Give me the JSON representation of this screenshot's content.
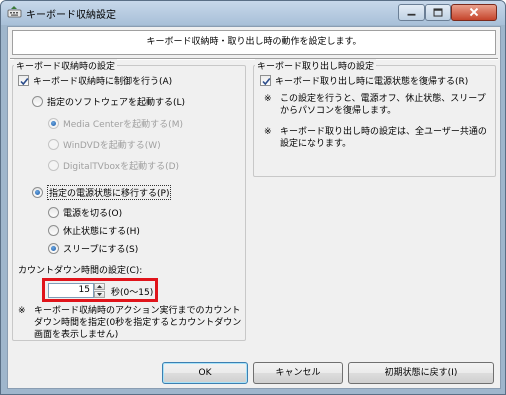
{
  "window": {
    "title": "キーボード収納設定",
    "icon": "keyboard-app-icon",
    "controls": [
      "minimize-icon",
      "maximize-icon",
      "close-icon"
    ]
  },
  "header": {
    "text": "キーボード収納時・取り出し時の動作を設定します。"
  },
  "storage": {
    "group_title": "キーボード収納時の設定",
    "control_checkbox": {
      "label": "キーボード収納時に制御を行う(A)",
      "checked": true
    },
    "launch_software": {
      "label": "指定のソフトウェアを起動する(L)",
      "selected": false,
      "options": [
        {
          "label": "Media Centerを起動する(M)",
          "selected": true,
          "enabled": false
        },
        {
          "label": "WinDVDを起動する(W)",
          "selected": false,
          "enabled": false
        },
        {
          "label": "DigitalTVboxを起動する(D)",
          "selected": false,
          "enabled": false
        }
      ]
    },
    "power_state": {
      "label": "指定の電源状態に移行する(P)",
      "selected": true,
      "options": [
        {
          "label": "電源を切る(O)",
          "selected": false
        },
        {
          "label": "休止状態にする(H)",
          "selected": false
        },
        {
          "label": "スリープにする(S)",
          "selected": true
        }
      ]
    },
    "countdown": {
      "label": "カウントダウン時間の設定(C):",
      "value": "15",
      "unit": "秒(0～15)",
      "note_mark": "※",
      "note": "キーボード収納時のアクション実行までのカウントダウン時間を指定(0秒を指定するとカウントダウン画面を表示しません)"
    }
  },
  "removal": {
    "group_title": "キーボード取り出し時の設定",
    "restore_checkbox": {
      "label": "キーボード取り出し時に電源状態を復帰する(R)",
      "checked": true
    },
    "notes": [
      {
        "mark": "※",
        "text": "この設定を行うと、電源オフ、休止状態、スリープからパソコンを復帰します。"
      },
      {
        "mark": "※",
        "text": "キーボード取り出し時の設定は、全ユーザー共通の設定になります。"
      }
    ]
  },
  "buttons": {
    "ok": "OK",
    "cancel": "キャンセル",
    "reset": "初期状態に戻す(I)"
  },
  "colors": {
    "highlight_border": "#e0141b",
    "title_bar": "#a8c0d8",
    "dialog_bg": "#f0f0f0"
  }
}
